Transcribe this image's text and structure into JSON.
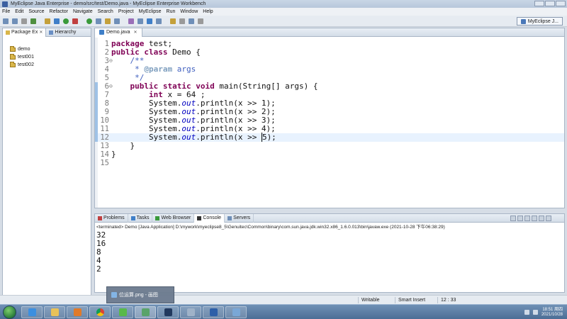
{
  "window": {
    "title": "MyEclipse Java Enterprise - demo/src/test/Demo.java - MyEclipse Enterprise Workbench"
  },
  "menu": [
    "File",
    "Edit",
    "Source",
    "Refactor",
    "Navigate",
    "Search",
    "Project",
    "MyEclipse",
    "Run",
    "Window",
    "Help"
  ],
  "perspective": {
    "label": "MyEclipse J..."
  },
  "left_view": {
    "tabs": [
      "Package Ex",
      "Hierarchy"
    ],
    "projects": [
      "demo",
      "test001",
      "test002"
    ]
  },
  "editor": {
    "tab": "Demo.java",
    "lines": [
      {
        "n": "1",
        "fold": "",
        "tokens": [
          {
            "t": "package",
            "c": "kw"
          },
          {
            "t": " test;",
            "c": ""
          }
        ]
      },
      {
        "n": "2",
        "fold": "",
        "tokens": [
          {
            "t": "public",
            "c": "kw"
          },
          {
            "t": " ",
            "c": ""
          },
          {
            "t": "class",
            "c": "kw"
          },
          {
            "t": " Demo {",
            "c": ""
          }
        ]
      },
      {
        "n": "3",
        "fold": "⊖",
        "tokens": [
          {
            "t": "    /**",
            "c": "cm"
          }
        ]
      },
      {
        "n": "4",
        "fold": "",
        "tokens": [
          {
            "t": "     * ",
            "c": "cm"
          },
          {
            "t": "@param",
            "c": "jd"
          },
          {
            "t": " args",
            "c": "cm"
          }
        ]
      },
      {
        "n": "5",
        "fold": "",
        "tokens": [
          {
            "t": "     */",
            "c": "cm"
          }
        ]
      },
      {
        "n": "6",
        "fold": "⊖",
        "tokens": [
          {
            "t": "    ",
            "c": ""
          },
          {
            "t": "public",
            "c": "kw"
          },
          {
            "t": " ",
            "c": ""
          },
          {
            "t": "static",
            "c": "kw"
          },
          {
            "t": " ",
            "c": ""
          },
          {
            "t": "void",
            "c": "kw"
          },
          {
            "t": " main(String[] args) {",
            "c": ""
          }
        ]
      },
      {
        "n": "7",
        "fold": "",
        "tokens": [
          {
            "t": "        ",
            "c": ""
          },
          {
            "t": "int",
            "c": "kw"
          },
          {
            "t": " x = 64 ;",
            "c": ""
          }
        ]
      },
      {
        "n": "8",
        "fold": "",
        "tokens": [
          {
            "t": "        System.",
            "c": ""
          },
          {
            "t": "out",
            "c": "it"
          },
          {
            "t": ".println(x >> 1);",
            "c": ""
          }
        ]
      },
      {
        "n": "9",
        "fold": "",
        "tokens": [
          {
            "t": "        System.",
            "c": ""
          },
          {
            "t": "out",
            "c": "it"
          },
          {
            "t": ".println(x >> 2);",
            "c": ""
          }
        ]
      },
      {
        "n": "10",
        "fold": "",
        "tokens": [
          {
            "t": "        System.",
            "c": ""
          },
          {
            "t": "out",
            "c": "it"
          },
          {
            "t": ".println(x >> 3);",
            "c": ""
          }
        ]
      },
      {
        "n": "11",
        "fold": "",
        "tokens": [
          {
            "t": "        System.",
            "c": ""
          },
          {
            "t": "out",
            "c": "it"
          },
          {
            "t": ".println(x >> 4);",
            "c": ""
          }
        ]
      },
      {
        "n": "12",
        "fold": "",
        "tokens": [
          {
            "t": "        System.",
            "c": ""
          },
          {
            "t": "out",
            "c": "it"
          },
          {
            "t": ".println(x >> ",
            "c": ""
          },
          {
            "t": "5",
            "c": "cursor"
          },
          {
            "t": ");",
            "c": ""
          }
        ]
      },
      {
        "n": "13",
        "fold": "",
        "tokens": [
          {
            "t": "    }",
            "c": ""
          }
        ]
      },
      {
        "n": "14",
        "fold": "",
        "tokens": [
          {
            "t": "}",
            "c": ""
          }
        ]
      },
      {
        "n": "15",
        "fold": "",
        "tokens": []
      }
    ],
    "current_line": 12
  },
  "bottom_view": {
    "tabs": [
      "Problems",
      "Tasks",
      "Web Browser",
      "Console",
      "Servers"
    ],
    "active_tab": "Console",
    "terminated": "<terminated> Demo [Java Application] D:\\mywork\\myeclipse8_5\\Genuitec\\Common\\binary\\com.sun.java.jdk.win32.x86_1.6.0.013\\bin\\javaw.exe (2021-10-28 下午06:38:29)",
    "output": [
      "32",
      "16",
      "8",
      "4",
      "2"
    ]
  },
  "status": {
    "writable": "Writable",
    "insert_mode": "Smart Insert",
    "position": "12 : 33"
  },
  "hover_preview": {
    "label": "位运算.png - 画图"
  },
  "clock": {
    "time": "18:51 周四",
    "date": "2021/10/28"
  }
}
